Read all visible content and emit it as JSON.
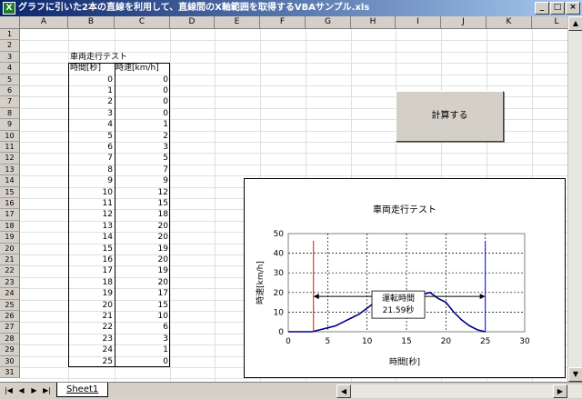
{
  "window": {
    "title": "グラフに引いた2本の直線を利用して、直線間のX軸範囲を取得するVBAサンプル.xls",
    "icon": "excel-icon",
    "buttons": {
      "minimize": "_",
      "restore": "□",
      "close": "×"
    }
  },
  "columns": [
    "A",
    "B",
    "C",
    "D",
    "E",
    "F",
    "G",
    "H",
    "I",
    "J",
    "K",
    "L"
  ],
  "rows": [
    "1",
    "2",
    "3",
    "4",
    "5",
    "6",
    "7",
    "8",
    "9",
    "10",
    "11",
    "12",
    "13",
    "14",
    "15",
    "16",
    "17",
    "18",
    "19",
    "20",
    "21",
    "22",
    "23",
    "24",
    "25",
    "26",
    "27",
    "28",
    "29",
    "30",
    "31"
  ],
  "table": {
    "title": "車両走行テスト",
    "headers": [
      "時間[秒]",
      "時速[km/h]"
    ],
    "time": [
      "0",
      "1",
      "2",
      "3",
      "4",
      "5",
      "6",
      "7",
      "8",
      "9",
      "10",
      "11",
      "12",
      "13",
      "14",
      "15",
      "16",
      "17",
      "18",
      "19",
      "20",
      "21",
      "22",
      "23",
      "24",
      "25"
    ],
    "speed": [
      "0",
      "0",
      "0",
      "0",
      "1",
      "2",
      "3",
      "5",
      "7",
      "9",
      "12",
      "15",
      "18",
      "20",
      "20",
      "19",
      "20",
      "19",
      "20",
      "17",
      "15",
      "10",
      "6",
      "3",
      "1",
      "0"
    ]
  },
  "button": {
    "label": "計算する"
  },
  "chart_data": {
    "type": "line",
    "title": "車両走行テスト",
    "xlabel": "時間[秒]",
    "ylabel": "時速[km/h]",
    "xlim": [
      0,
      30
    ],
    "ylim": [
      0,
      50
    ],
    "xticks": [
      "0",
      "5",
      "10",
      "15",
      "20",
      "25",
      "30"
    ],
    "yticks": [
      "0",
      "10",
      "20",
      "30",
      "40",
      "50"
    ],
    "grid": true,
    "series": [
      {
        "x": [
          0,
          1,
          2,
          3,
          4,
          5,
          6,
          7,
          8,
          9,
          10,
          11,
          12,
          13,
          14,
          15,
          16,
          17,
          18,
          19,
          20,
          21,
          22,
          23,
          24,
          25
        ],
        "y": [
          0,
          0,
          0,
          0,
          1,
          2,
          3,
          5,
          7,
          9,
          12,
          15,
          18,
          20,
          20,
          19,
          20,
          19,
          20,
          17,
          15,
          10,
          6,
          3,
          1,
          0
        ]
      }
    ],
    "vlines": [
      3.2,
      25
    ],
    "arrow": [
      3.2,
      25
    ],
    "annotation": {
      "line1": "運転時間",
      "line2": "21.59秒"
    },
    "colors": {
      "series": "#000080",
      "left_line": "#ff0000",
      "right_line": "#0000ff"
    }
  },
  "sheet": {
    "tab": "Sheet1",
    "nav": [
      "|◀",
      "◀",
      "▶",
      "▶|"
    ]
  }
}
